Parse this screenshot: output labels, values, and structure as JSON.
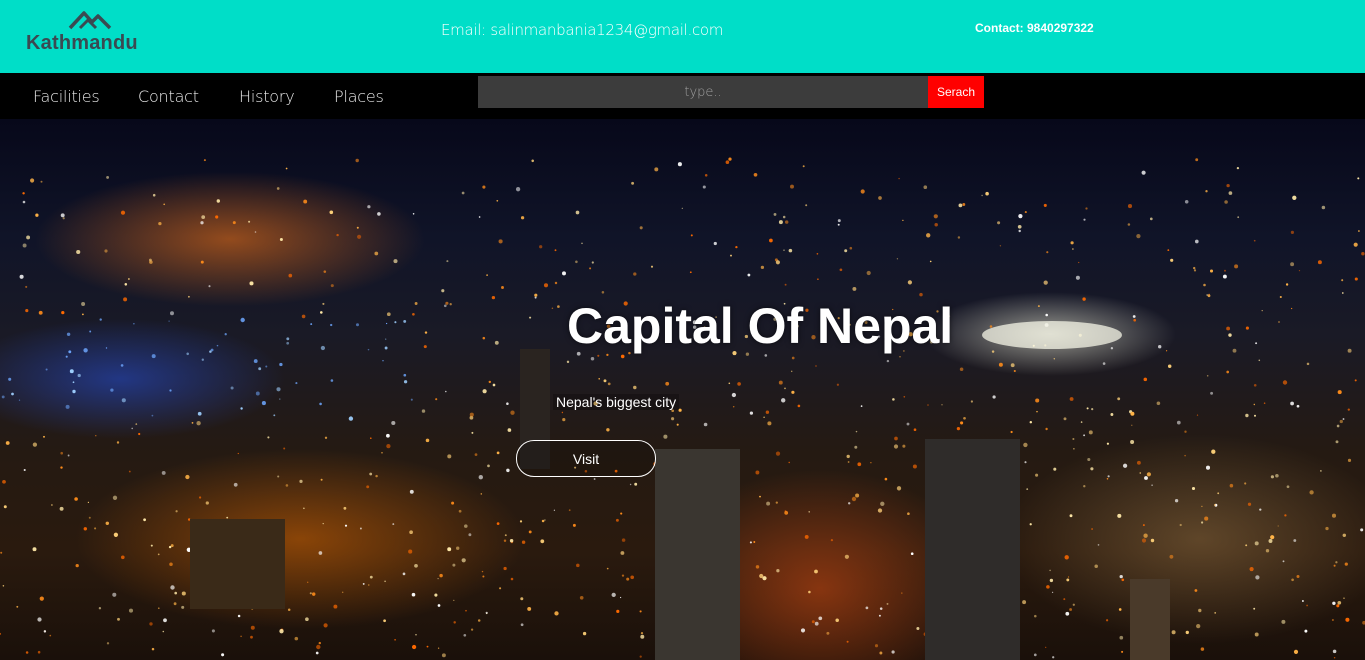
{
  "header": {
    "logo_text": "Kathmandu",
    "email": "Email: salinmanbania1234@gmail.com",
    "contact": "Contact: 9840297322",
    "accent_color": "#00dec8"
  },
  "nav": {
    "items": [
      {
        "label": "Facilities"
      },
      {
        "label": "Contact"
      },
      {
        "label": "History"
      },
      {
        "label": "Places"
      }
    ],
    "search": {
      "placeholder": "type..",
      "value": "",
      "button_label": "Serach",
      "button_color": "#ff0000"
    }
  },
  "hero": {
    "title": "Capital Of Nepal",
    "subtitle": "Nepal's biggest city",
    "button_label": "Visit",
    "background_description_icon": "night-city-image"
  }
}
